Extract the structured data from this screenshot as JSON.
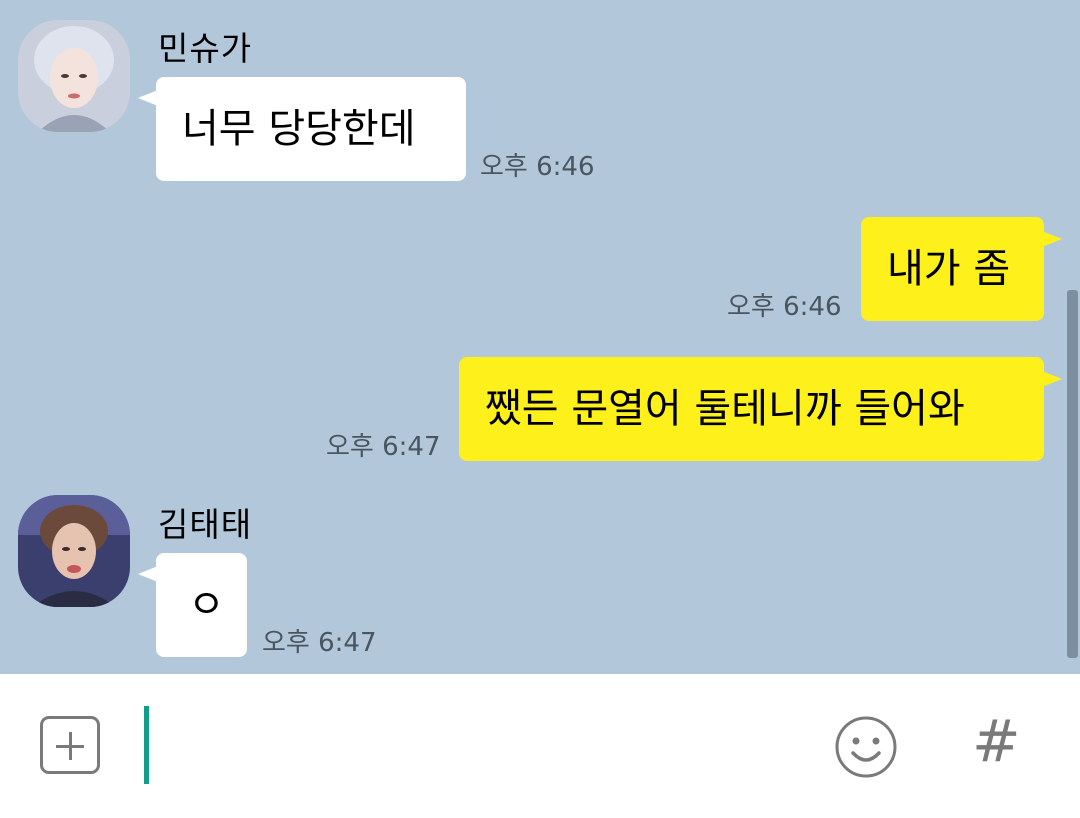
{
  "messages": [
    {
      "type": "incoming",
      "sender": "민슈가",
      "text": "너무 당당한데",
      "time": "오후 6:46",
      "avatar": "avatar-min-syuga"
    },
    {
      "type": "outgoing",
      "text": "내가 좀",
      "time": "오후 6:46"
    },
    {
      "type": "outgoing",
      "text": "쨌든 문열어 둘테니까 들어와",
      "time": "오후 6:47"
    },
    {
      "type": "incoming",
      "sender": "김태태",
      "text": "ㅇ",
      "time": "오후 6:47",
      "avatar": "avatar-kim-taetae"
    }
  ],
  "input": {
    "value": "",
    "placeholder": ""
  },
  "toolbar": {
    "hash_label": "#"
  },
  "icons": {
    "add": "plus-square-icon",
    "emoji": "smiley-icon",
    "hash": "hashtag-icon"
  },
  "colors": {
    "background": "#b2c7d9",
    "outgoing_bubble": "#fef01b",
    "incoming_bubble": "#ffffff",
    "caret": "#0f9e8a"
  }
}
